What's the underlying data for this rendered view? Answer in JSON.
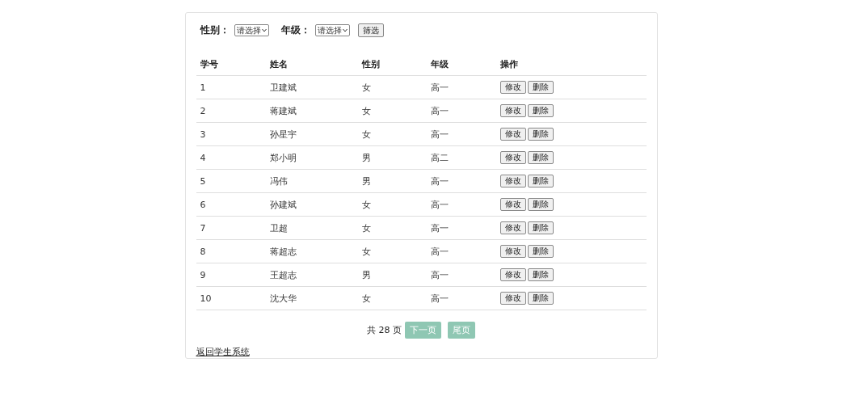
{
  "filters": [
    {
      "label": "性别：",
      "value": "请选择"
    },
    {
      "label": "年级：",
      "value": "请选择"
    }
  ],
  "filter_button": "筛选",
  "table": {
    "columns": [
      "学号",
      "姓名",
      "性别",
      "年级",
      "操作"
    ],
    "rows": [
      {
        "cells": [
          "1",
          "卫建斌",
          "女",
          "高一"
        ],
        "actions": [
          "修改",
          "删除"
        ]
      },
      {
        "cells": [
          "2",
          "蒋建斌",
          "女",
          "高一"
        ],
        "actions": [
          "修改",
          "删除"
        ]
      },
      {
        "cells": [
          "3",
          "孙星宇",
          "女",
          "高一"
        ],
        "actions": [
          "修改",
          "删除"
        ]
      },
      {
        "cells": [
          "4",
          "郑小明",
          "男",
          "高二"
        ],
        "actions": [
          "修改",
          "删除"
        ]
      },
      {
        "cells": [
          "5",
          "冯伟",
          "男",
          "高一"
        ],
        "actions": [
          "修改",
          "删除"
        ]
      },
      {
        "cells": [
          "6",
          "孙建斌",
          "女",
          "高一"
        ],
        "actions": [
          "修改",
          "删除"
        ]
      },
      {
        "cells": [
          "7",
          "卫超",
          "女",
          "高一"
        ],
        "actions": [
          "修改",
          "删除"
        ]
      },
      {
        "cells": [
          "8",
          "蒋超志",
          "女",
          "高一"
        ],
        "actions": [
          "修改",
          "删除"
        ]
      },
      {
        "cells": [
          "9",
          "王超志",
          "男",
          "高一"
        ],
        "actions": [
          "修改",
          "删除"
        ]
      },
      {
        "cells": [
          "10",
          "沈大华",
          "女",
          "高一"
        ],
        "actions": [
          "修改",
          "删除"
        ]
      }
    ]
  },
  "pagination": {
    "total": "共 28 页",
    "buttons": [
      "下一页",
      "尾页"
    ]
  },
  "back_link": "返回学生系统"
}
